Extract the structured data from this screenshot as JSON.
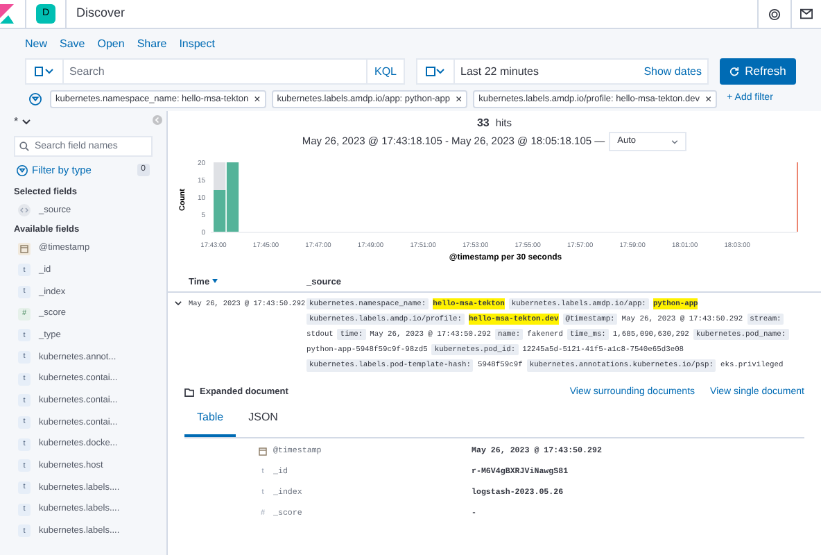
{
  "header": {
    "space_letter": "D",
    "title": "Discover"
  },
  "nav": [
    "New",
    "Save",
    "Open",
    "Share",
    "Inspect"
  ],
  "search": {
    "placeholder": "Search",
    "language": "KQL"
  },
  "time": {
    "value": "Last 22 minutes",
    "show_dates": "Show dates",
    "refresh": "Refresh"
  },
  "filters": [
    {
      "label": "kubernetes.namespace_name: hello-msa-tekton",
      "close": "×"
    },
    {
      "label": "kubernetes.labels.amdp.io/app: python-app",
      "close": "×"
    },
    {
      "label": "kubernetes.labels.amdp.io/profile: hello-msa-tekton.dev",
      "close": "×"
    }
  ],
  "add_filter": "+ Add filter",
  "sidebar": {
    "index_pattern": "*",
    "search_placeholder": "Search field names",
    "filter_by_type": "Filter by type",
    "filter_count": "0",
    "selected_heading": "Selected fields",
    "selected": [
      {
        "name": "_source",
        "kind": "source"
      }
    ],
    "available_heading": "Available fields",
    "available": [
      {
        "name": "@timestamp",
        "kind": "date"
      },
      {
        "name": "_id",
        "kind": "string",
        "icon": "t"
      },
      {
        "name": "_index",
        "kind": "string",
        "icon": "t"
      },
      {
        "name": "_score",
        "kind": "number",
        "icon": "#"
      },
      {
        "name": "_type",
        "kind": "string",
        "icon": "t"
      },
      {
        "name": "kubernetes.annot...",
        "kind": "string",
        "icon": "t"
      },
      {
        "name": "kubernetes.contai...",
        "kind": "string",
        "icon": "t"
      },
      {
        "name": "kubernetes.contai...",
        "kind": "string",
        "icon": "t"
      },
      {
        "name": "kubernetes.contai...",
        "kind": "string",
        "icon": "t"
      },
      {
        "name": "kubernetes.docke...",
        "kind": "string",
        "icon": "t"
      },
      {
        "name": "kubernetes.host",
        "kind": "string",
        "icon": "t"
      },
      {
        "name": "kubernetes.labels....",
        "kind": "string",
        "icon": "t"
      },
      {
        "name": "kubernetes.labels....",
        "kind": "string",
        "icon": "t"
      },
      {
        "name": "kubernetes.labels....",
        "kind": "string",
        "icon": "t"
      }
    ]
  },
  "hits": {
    "count": "33",
    "label": "hits"
  },
  "range": {
    "text": "May 26, 2023 @ 17:43:18.105 - May 26, 2023 @ 18:05:18.105 —",
    "interval": "Auto"
  },
  "chart_data": {
    "type": "bar",
    "ylabel": "Count",
    "xlabel": "@timestamp per 30 seconds",
    "stacked": true,
    "categories": [
      "17:43:00",
      null,
      null,
      null,
      "17:45:00",
      null,
      null,
      null,
      "17:47:00",
      null,
      null,
      null,
      "17:49:00",
      null,
      null,
      null,
      "17:51:00",
      null,
      null,
      null,
      "17:53:00",
      null,
      null,
      null,
      "17:55:00",
      null,
      null,
      null,
      "17:57:00",
      null,
      null,
      null,
      "17:59:00",
      null,
      null,
      null,
      "18:01:00",
      null,
      null,
      null,
      "18:03:00",
      null,
      null,
      null,
      null
    ],
    "series": [
      {
        "color": "#54b399",
        "values": [
          12,
          20,
          0,
          0,
          0,
          0,
          0,
          0,
          0,
          0,
          0,
          0,
          0,
          0,
          0,
          0,
          0,
          0,
          0,
          0,
          0,
          0,
          0,
          0,
          0,
          0,
          0,
          0,
          0,
          0,
          0,
          0,
          0,
          0,
          0,
          0,
          0,
          0,
          0,
          0,
          0,
          0,
          0,
          0,
          0
        ]
      },
      {
        "color": "#dfe1e5",
        "values": [
          8,
          0,
          0,
          0,
          0,
          0,
          0,
          0,
          0,
          0,
          0,
          0,
          0,
          0,
          0,
          0,
          0,
          0,
          0,
          0,
          0,
          0,
          0,
          0,
          0,
          0,
          0,
          0,
          0,
          0,
          0,
          0,
          0,
          0,
          0,
          0,
          0,
          0,
          0,
          0,
          0,
          0,
          0,
          0,
          0
        ]
      }
    ],
    "ylim": [
      0,
      20
    ],
    "yticks": [
      0,
      5,
      10,
      15,
      20
    ]
  },
  "table": {
    "columns": [
      "Time",
      "_source"
    ],
    "rows": [
      {
        "expanded": true,
        "time": "May 26, 2023 @ 17:43:50.292",
        "source": [
          {
            "key": "kubernetes.namespace_name:",
            "value": "hello-msa-tekton",
            "highlighted": true
          },
          {
            "key": "kubernetes.labels.amdp.io/app:",
            "value": "python-app",
            "highlighted": true
          },
          {
            "key": "kubernetes.labels.amdp.io/profile:",
            "value": "hello-msa-tekton.dev",
            "highlighted": true
          },
          {
            "key": "@timestamp:",
            "value": "May 26, 2023 @ 17:43:50.292",
            "highlighted": false
          },
          {
            "key": "stream:",
            "value": "stdout",
            "highlighted": false
          },
          {
            "key": "time:",
            "value": "May 26, 2023 @ 17:43:50.292",
            "highlighted": false
          },
          {
            "key": "name:",
            "value": "fakenerd",
            "highlighted": false
          },
          {
            "key": "time_ms:",
            "value": "1,685,090,630,292",
            "highlighted": false
          },
          {
            "key": "kubernetes.pod_name:",
            "value": "python-app-5948f59c9f-98zd5",
            "highlighted": false
          },
          {
            "key": "kubernetes.pod_id:",
            "value": "12245a5d-5121-41f5-a1c8-7540e65d3e08",
            "highlighted": false
          },
          {
            "key": "kubernetes.labels.pod-template-hash:",
            "value": "5948f59c9f",
            "highlighted": false
          },
          {
            "key": "kubernetes.annotations.kubernetes.io/psp:",
            "value": "eks.privileged",
            "highlighted": false
          }
        ]
      }
    ]
  },
  "expanded": {
    "title": "Expanded document",
    "links": [
      "View surrounding documents",
      "View single document"
    ],
    "tabs": [
      {
        "label": "Table",
        "selected": true
      },
      {
        "label": "JSON",
        "selected": false
      }
    ],
    "fields": [
      {
        "kind": "date",
        "name": "@timestamp",
        "value": "May 26, 2023 @ 17:43:50.292"
      },
      {
        "kind": "string",
        "icon": "t",
        "name": "_id",
        "value": "r-M6V4gBXRJViNawgS81"
      },
      {
        "kind": "string",
        "icon": "t",
        "name": "_index",
        "value": "logstash-2023.05.26"
      },
      {
        "kind": "number",
        "icon": "#",
        "name": "_score",
        "value": "-"
      }
    ]
  }
}
